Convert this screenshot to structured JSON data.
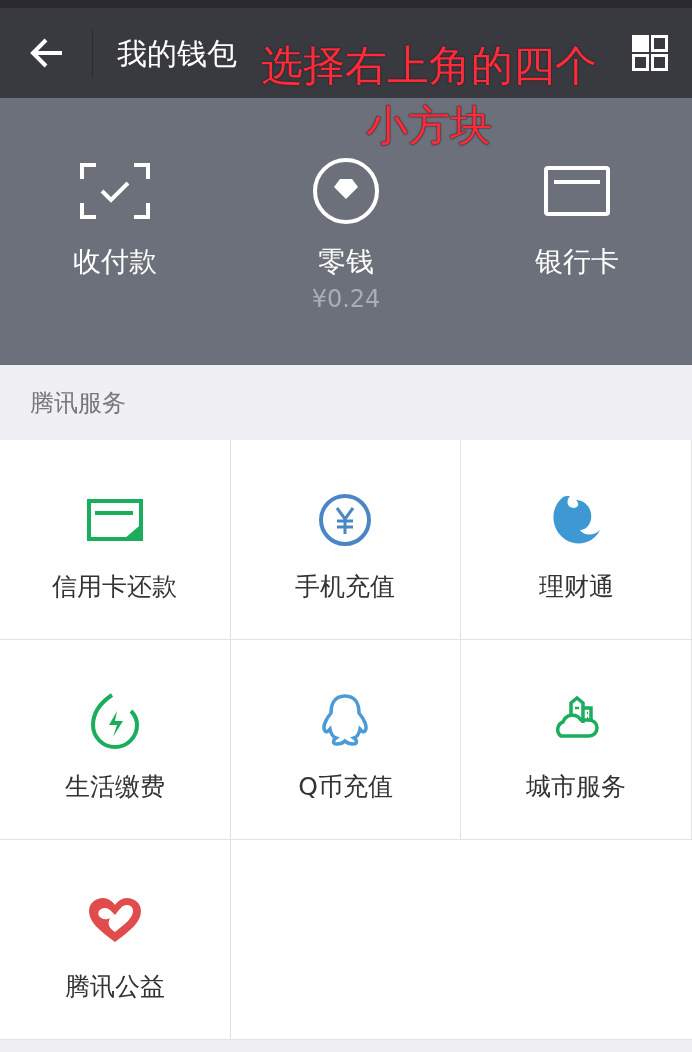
{
  "header": {
    "title": "我的钱包"
  },
  "annotation": "选择右上角的四个小方块",
  "top_actions": [
    {
      "kind": "scan",
      "label": "收付款"
    },
    {
      "kind": "change",
      "label": "零钱",
      "amount": "¥0.24"
    },
    {
      "kind": "card",
      "label": "银行卡"
    }
  ],
  "section": {
    "title": "腾讯服务"
  },
  "services": [
    {
      "kind": "card",
      "label": "信用卡还款"
    },
    {
      "kind": "yen",
      "label": "手机充值"
    },
    {
      "kind": "fish",
      "label": "理财通"
    },
    {
      "kind": "bolt",
      "label": "生活缴费"
    },
    {
      "kind": "penguin",
      "label": "Q币充值"
    },
    {
      "kind": "city",
      "label": "城市服务"
    },
    {
      "kind": "heart",
      "label": "腾讯公益"
    }
  ]
}
